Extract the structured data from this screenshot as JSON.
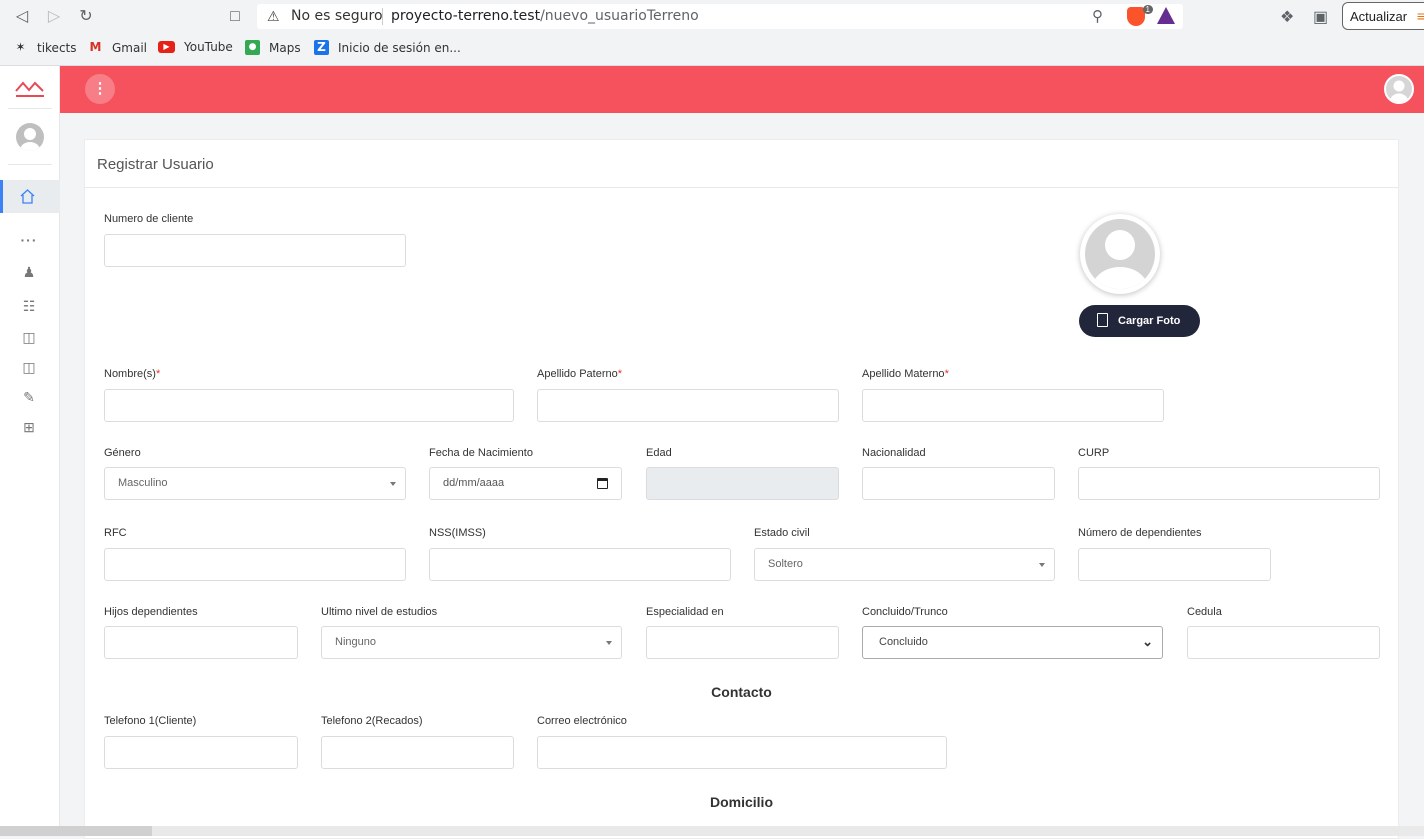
{
  "browser": {
    "security_label": "No es seguro",
    "url_host": "proyecto-terreno.test",
    "url_path": "/nuevo_usuarioTerreno",
    "brave_badge": "1",
    "update_label": "Actualizar"
  },
  "bookmarks": [
    {
      "label": "tikects",
      "icon": "star-icon"
    },
    {
      "label": "Gmail",
      "icon": "gmail-icon"
    },
    {
      "label": "YouTube",
      "icon": "youtube-icon"
    },
    {
      "label": "Maps",
      "icon": "maps-icon"
    },
    {
      "label": "Inicio de sesión en...",
      "icon": "z-icon"
    }
  ],
  "colors": {
    "accent": "#f5525e",
    "dark_button": "#22263a",
    "sidebar_active": "#3b82f6"
  },
  "card": {
    "title": "Registrar Usuario"
  },
  "form": {
    "client_number_label": "Numero de cliente",
    "upload_label": "Cargar Foto",
    "nombre_label": "Nombre(s)",
    "paterno_label": "Apellido Paterno",
    "materno_label": "Apellido Materno",
    "required_mark": "*",
    "genero_label": "Género",
    "genero_value": "Masculino",
    "fecha_label": "Fecha de Nacimiento",
    "fecha_placeholder": "dd/mm/aaaa",
    "edad_label": "Edad",
    "nacionalidad_label": "Nacionalidad",
    "curp_label": "CURP",
    "rfc_label": "RFC",
    "nss_label": "NSS(IMSS)",
    "estado_civil_label": "Estado civil",
    "estado_civil_value": "Soltero",
    "dependientes_label": "Número de dependientes",
    "hijos_label": "Hijos dependientes",
    "estudios_label": "Ultimo nivel de estudios",
    "estudios_value": "Ninguno",
    "especialidad_label": "Especialidad en",
    "concluido_label": "Concluido/Trunco",
    "concluido_value": "Concluido",
    "cedula_label": "Cedula",
    "contacto_title": "Contacto",
    "tel1_label": "Telefono 1(Cliente)",
    "tel2_label": "Telefono 2(Recados)",
    "correo_label": "Correo electrónico",
    "domicilio_title": "Domicilio"
  }
}
